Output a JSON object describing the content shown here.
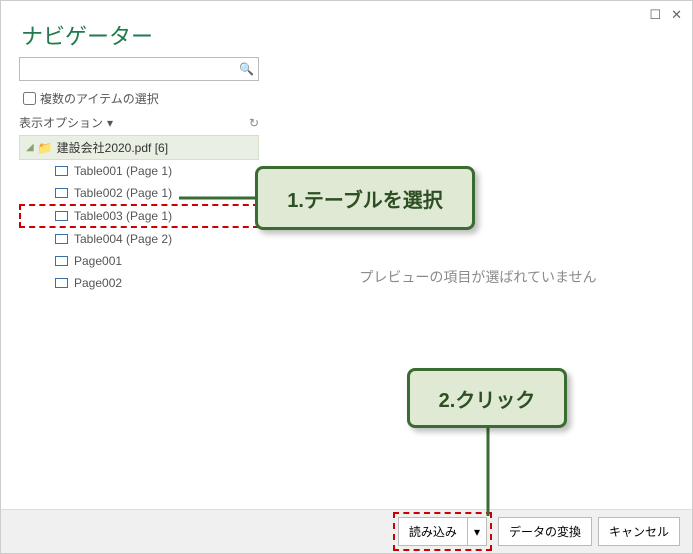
{
  "window": {
    "title": "ナビゲーター"
  },
  "left": {
    "search_placeholder": "",
    "multi_select_label": "複数のアイテムの選択",
    "display_options_label": "表示オプション",
    "root_label": "建設会社2020.pdf [6]",
    "items": [
      "Table001 (Page 1)",
      "Table002 (Page 1)",
      "Table003 (Page 1)",
      "Table004 (Page 2)",
      "Page001",
      "Page002"
    ]
  },
  "preview": {
    "empty_message": "プレビューの項目が選ばれていません"
  },
  "callouts": {
    "c1": "1.テーブルを選択",
    "c2": "2.クリック"
  },
  "footer": {
    "load_label": "読み込み",
    "transform_label": "データの変換",
    "cancel_label": "キャンセル"
  }
}
